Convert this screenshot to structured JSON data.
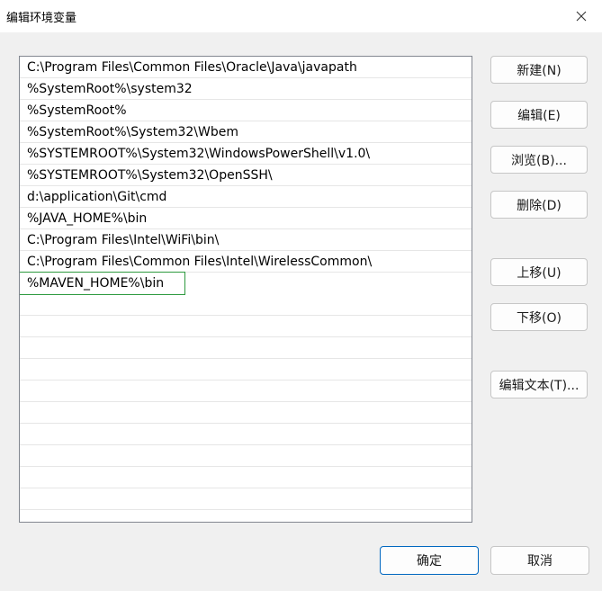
{
  "window": {
    "title": "编辑环境变量",
    "close_icon": "close-icon"
  },
  "list": {
    "items": [
      "C:\\Program Files\\Common Files\\Oracle\\Java\\javapath",
      "%SystemRoot%\\system32",
      "%SystemRoot%",
      "%SystemRoot%\\System32\\Wbem",
      "%SYSTEMROOT%\\System32\\WindowsPowerShell\\v1.0\\",
      "%SYSTEMROOT%\\System32\\OpenSSH\\",
      "d:\\application\\Git\\cmd",
      "%JAVA_HOME%\\bin",
      "C:\\Program Files\\Intel\\WiFi\\bin\\",
      "C:\\Program Files\\Common Files\\Intel\\WirelessCommon\\",
      "%MAVEN_HOME%\\bin"
    ],
    "selected_index": 10,
    "selection_color": "#2e9a3f"
  },
  "buttons": {
    "new": "新建(N)",
    "edit": "编辑(E)",
    "browse": "浏览(B)...",
    "delete": "删除(D)",
    "move_up": "上移(U)",
    "move_down": "下移(O)",
    "edit_text": "编辑文本(T)...",
    "ok": "确定",
    "cancel": "取消"
  },
  "colors": {
    "ok_border": "#0067c0"
  }
}
